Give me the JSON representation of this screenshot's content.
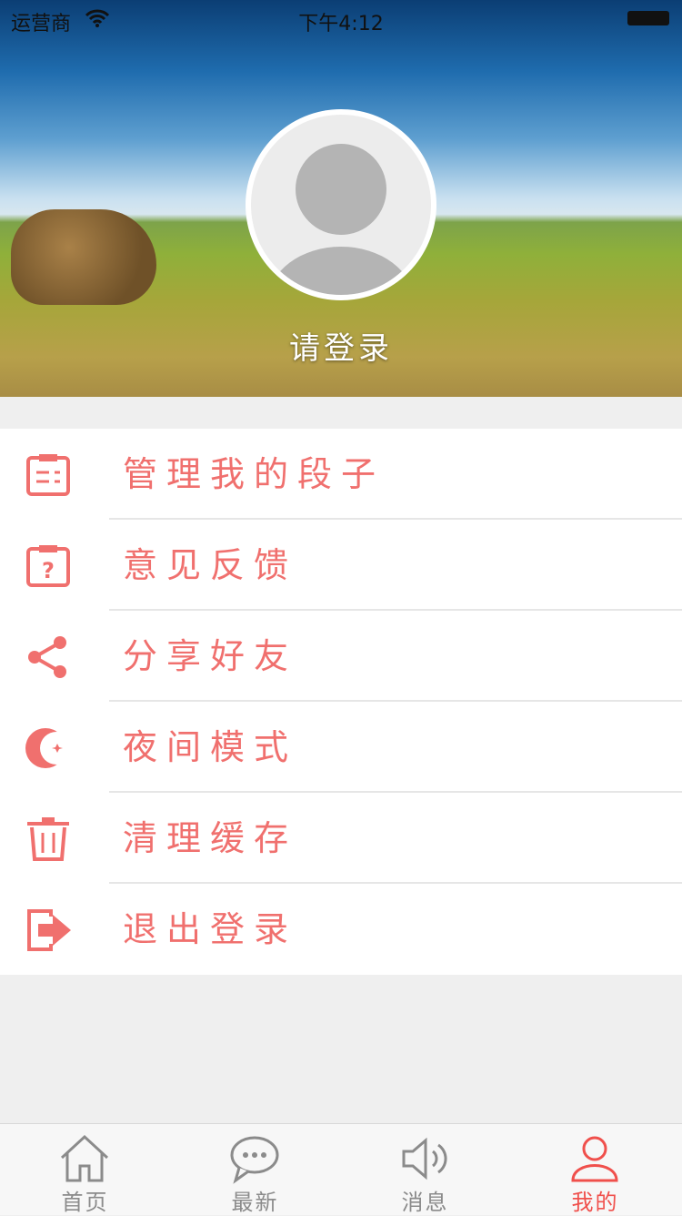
{
  "status_bar": {
    "carrier": "运营商",
    "time": "下午4:12"
  },
  "profile": {
    "login_prompt": "请登录"
  },
  "menu": [
    {
      "label": "管理我的段子",
      "icon": "clipboard-list-icon"
    },
    {
      "label": "意见反馈",
      "icon": "clipboard-question-icon"
    },
    {
      "label": "分享好友",
      "icon": "share-icon"
    },
    {
      "label": "夜间模式",
      "icon": "moon-star-icon"
    },
    {
      "label": "清理缓存",
      "icon": "trash-icon"
    },
    {
      "label": "退出登录",
      "icon": "logout-icon"
    }
  ],
  "tabbar": [
    {
      "label": "首页",
      "icon": "home-icon",
      "active": false
    },
    {
      "label": "最新",
      "icon": "chat-bubble-icon",
      "active": false
    },
    {
      "label": "消息",
      "icon": "speaker-icon",
      "active": false
    },
    {
      "label": "我的",
      "icon": "user-icon",
      "active": true
    }
  ],
  "colors": {
    "accent": "#f0706e",
    "tab_active": "#f0504c",
    "tab_inactive": "#8b8b8b"
  }
}
